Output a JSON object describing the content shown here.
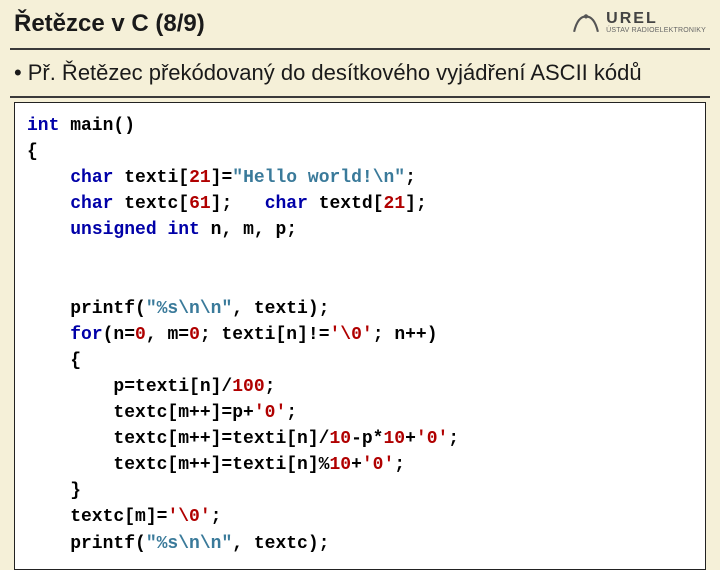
{
  "header": {
    "title": "Řetězce v C (8/9)",
    "logo": {
      "main": "UREL",
      "sub": "ÚSTAV RADIOELEKTRONIKY"
    }
  },
  "subtitle": {
    "bullet": "•",
    "text": "Př. Řetězec překódovaný do desítkového vyjádření ASCII kódů"
  },
  "code": {
    "l01a": "int",
    "l01b": " main()",
    "l02": "{",
    "l03a": "    ",
    "l03b": "char",
    "l03c": " texti[",
    "l03d": "21",
    "l03e": "]=",
    "l03f": "\"Hello world!\\n\"",
    "l03g": ";",
    "l04a": "    ",
    "l04b": "char",
    "l04c": " textc[",
    "l04d": "61",
    "l04e": "];   ",
    "l04f": "char",
    "l04g": " textd[",
    "l04h": "21",
    "l04i": "];",
    "l05a": "    ",
    "l05b": "unsigned",
    "l05c": " ",
    "l05d": "int",
    "l05e": " n, m, p;",
    "blank1": " ",
    "blank2": " ",
    "l06a": "    printf(",
    "l06b": "\"%s\\n\\n\"",
    "l06c": ", texti);",
    "l07a": "    ",
    "l07b": "for",
    "l07c": "(n=",
    "l07d": "0",
    "l07e": ", m=",
    "l07f": "0",
    "l07g": "; texti[n]!=",
    "l07h": "'\\0'",
    "l07i": "; n++)",
    "l08": "    {",
    "l09a": "        p=texti[n]/",
    "l09b": "100",
    "l09c": ";",
    "l10a": "        textc[m++]=p+",
    "l10b": "'0'",
    "l10c": ";",
    "l11a": "        textc[m++]=texti[n]/",
    "l11b": "10",
    "l11c": "-p*",
    "l11d": "10",
    "l11e": "+",
    "l11f": "'0'",
    "l11g": ";",
    "l12a": "        textc[m++]=texti[n]%",
    "l12b": "10",
    "l12c": "+",
    "l12d": "'0'",
    "l12e": ";",
    "l13": "    }",
    "l14a": "    textc[m]=",
    "l14b": "'\\0'",
    "l14c": ";",
    "l15a": "    printf(",
    "l15b": "\"%s\\n\\n\"",
    "l15c": ", textc);"
  }
}
